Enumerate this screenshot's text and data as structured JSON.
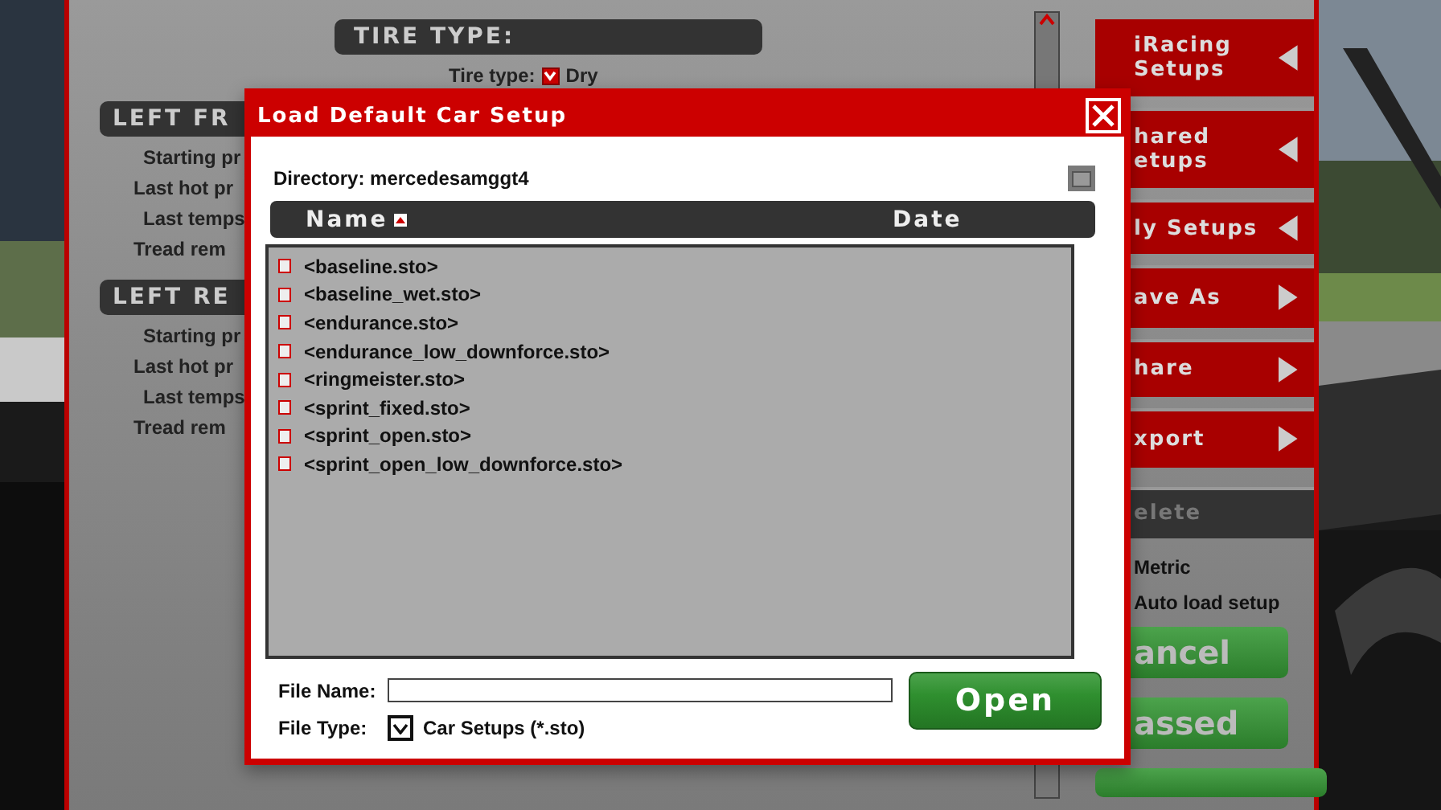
{
  "setup_panel": {
    "tire_section": {
      "header": "TIRE TYPE:",
      "field_label": "Tire type:",
      "checked": true,
      "value": "Dry"
    },
    "sections": [
      {
        "header": "LEFT FR",
        "rows": [
          "Starting pr",
          "Last hot pr",
          "Last temps",
          "Tread rem"
        ]
      },
      {
        "header": "LEFT RE",
        "rows": [
          "Starting pr",
          "Last hot pr",
          "Last temps",
          "Tread rem"
        ]
      }
    ]
  },
  "side_menu": {
    "items": [
      {
        "label": "iRacing Setups",
        "kind": "submenu"
      },
      {
        "label": "hared etups",
        "kind": "submenu"
      },
      {
        "label": "ly Setups",
        "kind": "submenu"
      },
      {
        "label": "ave As",
        "kind": "action"
      },
      {
        "label": "hare",
        "kind": "action"
      },
      {
        "label": "xport",
        "kind": "action"
      },
      {
        "label": "elete",
        "kind": "disabled"
      }
    ],
    "options": [
      "Metric",
      "Auto load setup"
    ],
    "buttons": [
      "ancel",
      "assed"
    ]
  },
  "dialog": {
    "title": "Load Default Car Setup",
    "directory_label": "Directory:",
    "directory": "mercedesamggt4",
    "columns": [
      "Name",
      "Date"
    ],
    "files": [
      "<baseline.sto>",
      "<baseline_wet.sto>",
      "<endurance.sto>",
      "<endurance_low_downforce.sto>",
      "<ringmeister.sto>",
      "<sprint_fixed.sto>",
      "<sprint_open.sto>",
      "<sprint_open_low_downforce.sto>"
    ],
    "file_name_label": "File Name:",
    "file_type_label": "File Type:",
    "file_type": {
      "checked": true,
      "value": "Car Setups (*.sto)"
    },
    "open_button": "Open"
  }
}
